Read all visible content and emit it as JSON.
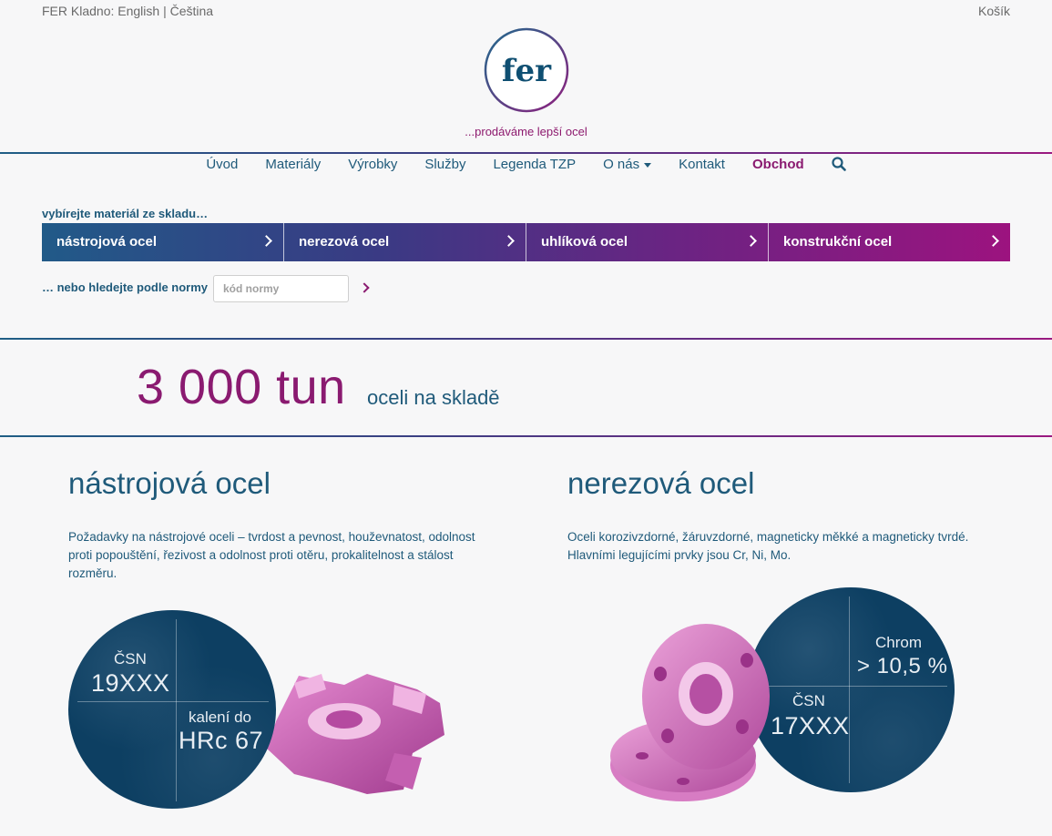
{
  "topbar": {
    "site": "FER Kladno:",
    "lang_en": "English",
    "lang_sep": "|",
    "lang_cs": "Čeština",
    "cart": "Košík"
  },
  "logo": {
    "text": "fer"
  },
  "tagline": "...prodáváme lepší ocel",
  "nav": {
    "items": [
      "Úvod",
      "Materiály",
      "Výrobky",
      "Služby",
      "Legenda TZP",
      "O nás",
      "Kontakt",
      "Obchod"
    ],
    "search_icon": "search-icon"
  },
  "materials": {
    "label": "vybírejte materiál ze skladu…",
    "items": [
      "nástrojová ocel",
      "nerezová ocel",
      "uhlíková ocel",
      "konstrukční ocel"
    ]
  },
  "norm": {
    "label": "… nebo hledejte podle normy",
    "placeholder": "kód normy"
  },
  "stock": {
    "amount": "3 000 tun",
    "text": "oceli na skladě"
  },
  "products": [
    {
      "title": "nástrojová ocel",
      "desc": "Požadavky na nástrojové oceli – tvrdost a pevnost, houževnatost, odolnost proti popouštění, řezivost a odolnost proti otěru, prokalitelnost a stálost rozměru.",
      "circle": {
        "l1": "ČSN",
        "v1": "19XXX",
        "l2": "kalení do",
        "v2": "HRc 67"
      }
    },
    {
      "title": "nerezová ocel",
      "desc": "Oceli korozivzdorné, žáruvzdorné, magneticky měkké a magneticky tvrdé. Hlavními legujícími prvky jsou Cr, Ni, Mo.",
      "circle": {
        "l1": "Chrom",
        "v1": "> 10,5 %",
        "l2": "ČSN",
        "v2": "17XXX"
      }
    }
  ],
  "colors": {
    "primary": "#1f5a7a",
    "accent": "#8a1a70",
    "circle": "#0d3f62"
  }
}
